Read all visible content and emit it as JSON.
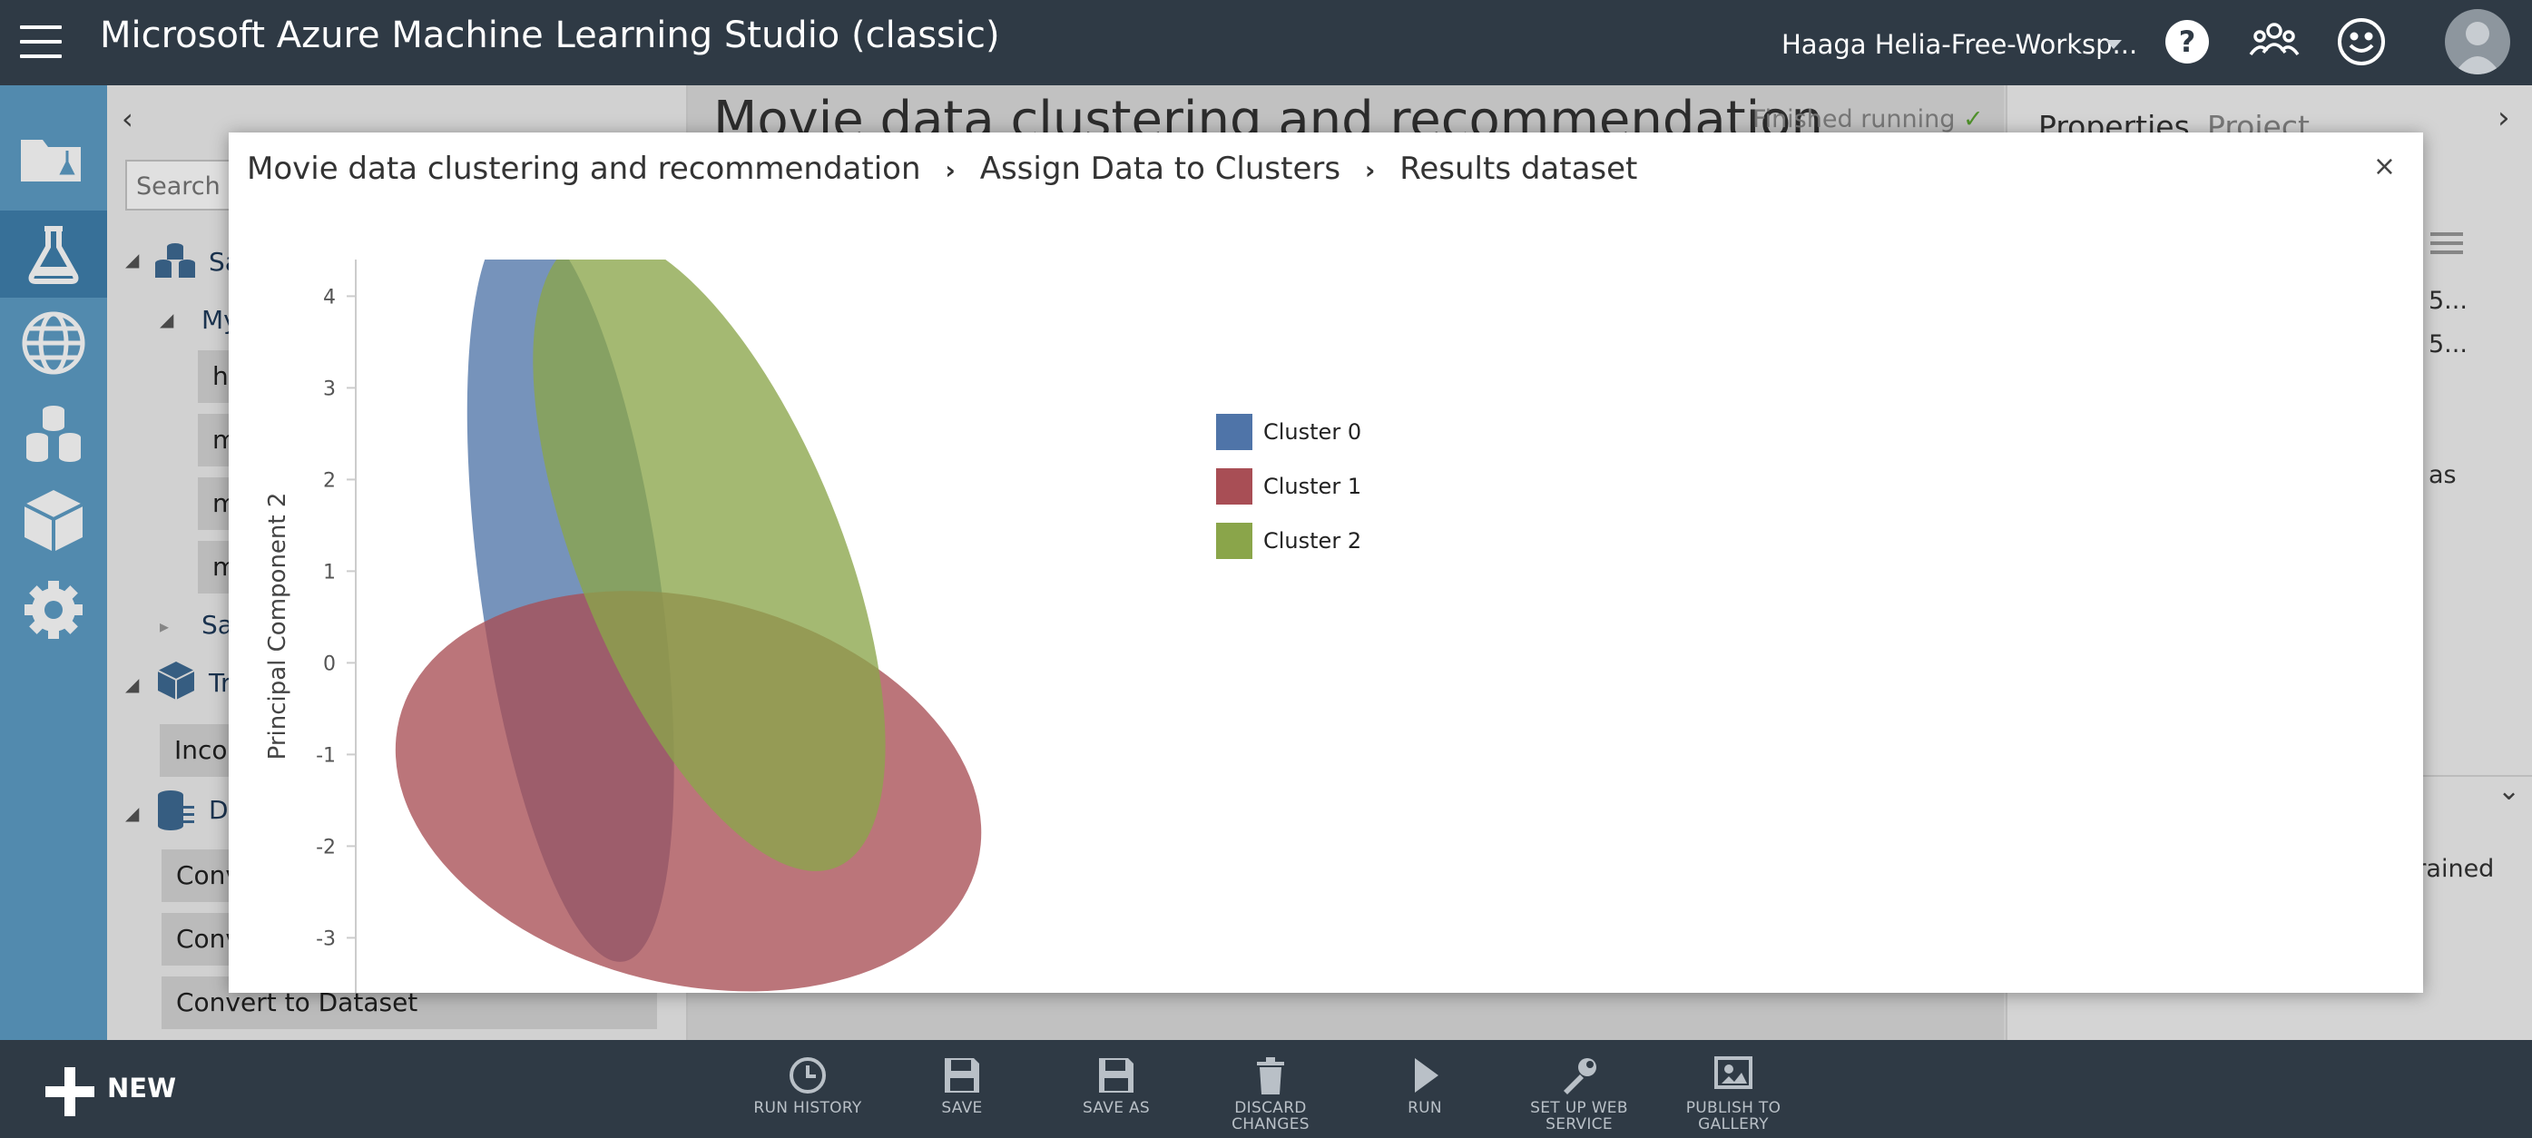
{
  "app": {
    "title": "Microsoft Azure Machine Learning Studio (classic)",
    "workspace": "Haaga Helia-Free-Worksp..."
  },
  "header_icons": [
    "help-icon",
    "community-icon",
    "feedback-smiley-icon",
    "user-avatar-icon"
  ],
  "nav_icons": [
    "projects-icon",
    "experiments-icon",
    "web-services-icon",
    "datasets-icon",
    "trained-models-icon",
    "settings-icon"
  ],
  "palette": {
    "search_placeholder": "Search ex",
    "rows": [
      {
        "label": "Sa"
      },
      {
        "label": "My"
      },
      {
        "label": "Sa"
      },
      {
        "label": "Tr"
      },
      {
        "label": "D"
      }
    ],
    "items": [
      "h",
      "m",
      "m",
      "m",
      "Inco",
      "Conv",
      "Conv",
      "Convert to Dataset"
    ]
  },
  "canvas": {
    "experiment_title": "Movie data clustering and recommendation",
    "status": "Finished running",
    "status_mark": "✓"
  },
  "properties": {
    "tabs": [
      "Properties",
      "Project"
    ],
    "fragments": [
      "5...",
      "5...",
      "as",
      "g trained"
    ]
  },
  "toolbar": {
    "new_label": "NEW",
    "buttons": [
      {
        "label": "RUN HISTORY",
        "icon": "history-icon"
      },
      {
        "label": "SAVE",
        "icon": "save-icon"
      },
      {
        "label": "SAVE AS",
        "icon": "save-as-icon"
      },
      {
        "label": "DISCARD CHANGES",
        "icon": "trash-icon"
      },
      {
        "label": "RUN",
        "icon": "play-icon"
      },
      {
        "label": "SET UP WEB SERVICE",
        "icon": "web-service-icon"
      },
      {
        "label": "PUBLISH TO GALLERY",
        "icon": "gallery-icon"
      }
    ]
  },
  "modal": {
    "breadcrumb": [
      "Movie data clustering and recommendation",
      "Assign Data to Clusters",
      "Results dataset"
    ],
    "breadcrumb_separator": "›",
    "close": "×"
  },
  "chart_data": {
    "type": "scatter",
    "ylabel": "Principal Component 2",
    "ylim": [
      -3.6,
      4.4
    ],
    "xlim": [
      -3.4,
      7.6
    ],
    "yticks": [
      4,
      3,
      2,
      1,
      0,
      -1,
      -2,
      -3
    ],
    "series": [
      {
        "name": "Cluster 0",
        "color": "#4f74a8",
        "ellipse": {
          "cx": -0.3,
          "cy": 0.8,
          "rx": 1.3,
          "ry": 4.1,
          "angle": -8
        }
      },
      {
        "name": "Cluster 1",
        "color": "#a84e55",
        "ellipse": {
          "cx": 1.4,
          "cy": -1.4,
          "rx": 4.3,
          "ry": 2.1,
          "angle": 14
        }
      },
      {
        "name": "Cluster 2",
        "color": "#8aa54a",
        "ellipse": {
          "cx": 1.7,
          "cy": 1.2,
          "rx": 1.9,
          "ry": 3.7,
          "angle": -22
        }
      }
    ]
  }
}
